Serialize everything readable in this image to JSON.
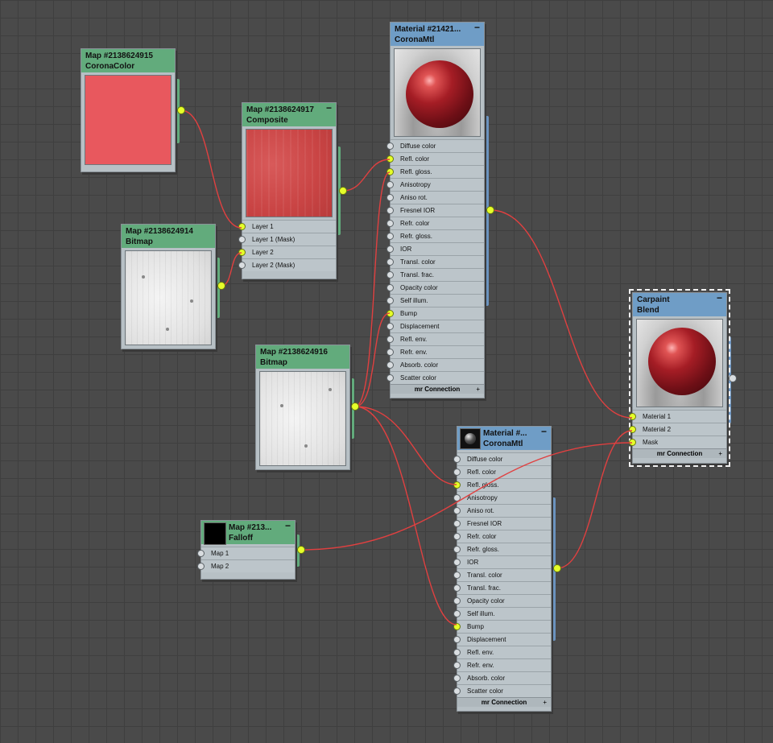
{
  "nodes": {
    "corona_color": {
      "title": "Map #2138624915",
      "type": "CoronaColor",
      "swatch_color": "#e8585e"
    },
    "composite": {
      "title": "Map #2138624917",
      "type": "Composite",
      "min": "−",
      "slots": [
        "Layer 1",
        "Layer 1 (Mask)",
        "Layer 2",
        "Layer 2 (Mask)"
      ]
    },
    "bitmap_914": {
      "title": "Map #2138624914",
      "type": "Bitmap"
    },
    "bitmap_916": {
      "title": "Map #2138624916",
      "type": "Bitmap"
    },
    "falloff": {
      "title": "Map #213...",
      "type": "Falloff",
      "min": "−",
      "slots": [
        "Map 1",
        "Map 2"
      ]
    },
    "material_top": {
      "title": "Material #21421...",
      "type": "CoronaMtl",
      "min": "−",
      "slots": [
        "Diffuse color",
        "Refl. color",
        "Refl. gloss.",
        "Anisotropy",
        "Aniso rot.",
        "Fresnel IOR",
        "Refr. color",
        "Refr. gloss.",
        "IOR",
        "Transl. color",
        "Transl. frac.",
        "Opacity color",
        "Self illum.",
        "Bump",
        "Displacement",
        "Refl. env.",
        "Refr. env.",
        "Absorb. color",
        "Scatter color"
      ],
      "footer": "mr Connection",
      "footer_plus": "+"
    },
    "material_bottom": {
      "title": "Material #...",
      "type": "CoronaMtl",
      "min": "−",
      "slots": [
        "Diffuse color",
        "Refl. color",
        "Refl. gloss.",
        "Anisotropy",
        "Aniso rot.",
        "Fresnel IOR",
        "Refr. color",
        "Refr. gloss.",
        "IOR",
        "Transl. color",
        "Transl. frac.",
        "Opacity color",
        "Self illum.",
        "Bump",
        "Displacement",
        "Refl. env.",
        "Refr. env.",
        "Absorb. color",
        "Scatter color"
      ],
      "footer": "mr Connection",
      "footer_plus": "+"
    },
    "blend": {
      "title": "Carpaint",
      "type": "Blend",
      "min": "−",
      "slots": [
        "Material 1",
        "Material 2",
        "Mask"
      ],
      "footer": "mr Connection",
      "footer_plus": "+"
    }
  },
  "colors": {
    "wire": "#e04040",
    "socket_on": "#e6ff2a",
    "material_header": "#6f9dc6",
    "map_header": "#62ab7c"
  }
}
